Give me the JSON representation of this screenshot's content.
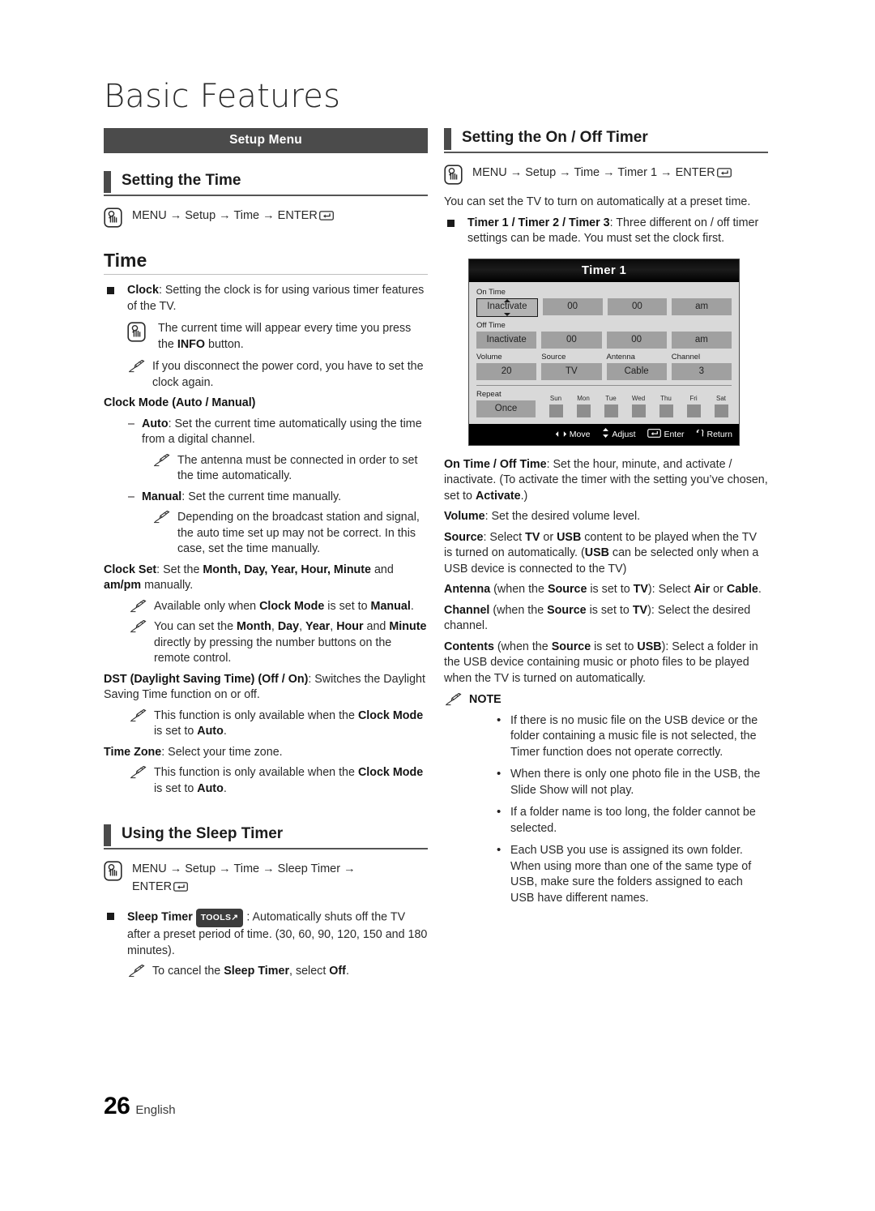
{
  "page": {
    "title": "Basic Features",
    "footer_number": "26",
    "footer_language": "English"
  },
  "left_column": {
    "banner": "Setup Menu",
    "section1_heading": "Setting the Time",
    "section1_path": "MENU → Setup → Time → ENTER",
    "subhead_time": "Time",
    "clock_item": {
      "term": "Clock",
      "text": ": Setting the clock is for using various timer features of the TV."
    },
    "clock_remote_note_pre": "The current time will appear every time you press the ",
    "clock_remote_note_bold": "INFO",
    "clock_remote_note_post": " button.",
    "clock_pencil_note": "If you disconnect the power cord, you have to set the clock again.",
    "clock_mode_heading": "Clock Mode (Auto / Manual)",
    "auto_term": "Auto",
    "auto_text": ": Set the current time automatically using the time from a digital channel.",
    "auto_note": "The antenna must be connected in order to set the time automatically.",
    "manual_term": "Manual",
    "manual_text": ": Set the current time manually.",
    "manual_note": "Depending on the broadcast station and signal, the auto time set up may not be correct. In this case, set the time manually.",
    "clock_set_term": "Clock Set",
    "clock_set_text_1": ": Set the ",
    "clock_set_bold_1": "Month, Day, Year, Hour, Minute",
    "clock_set_text_2": " and ",
    "clock_set_bold_2": "am/pm",
    "clock_set_text_3": " manually.",
    "clock_set_note_1_pre": "Available only when ",
    "clock_set_note_1_b1": "Clock Mode",
    "clock_set_note_1_mid": " is set to ",
    "clock_set_note_1_b2": "Manual",
    "clock_set_note_1_post": ".",
    "clock_set_note_2_pre": "You can set the ",
    "clock_set_note_2_b1": "Month",
    "clock_set_note_2_s1": ", ",
    "clock_set_note_2_b2": "Day",
    "clock_set_note_2_s2": ", ",
    "clock_set_note_2_b3": "Year",
    "clock_set_note_2_s3": ", ",
    "clock_set_note_2_b4": "Hour",
    "clock_set_note_2_s4": " and ",
    "clock_set_note_2_b5": "Minute",
    "clock_set_note_2_post": " directly by pressing the number buttons on the remote control.",
    "dst_term": "DST (Daylight Saving Time) (Off / On)",
    "dst_text": ": Switches the Daylight Saving Time function on or off.",
    "dst_note_pre": "This function is only available when the ",
    "dst_note_b1": "Clock Mode",
    "dst_note_mid": " is set to ",
    "dst_note_b2": "Auto",
    "dst_note_post": ".",
    "timezone_term": "Time Zone",
    "timezone_text": ": Select your time zone.",
    "timezone_note_pre": "This function is only available when the ",
    "timezone_note_b1": "Clock Mode",
    "timezone_note_mid": " is set to ",
    "timezone_note_b2": "Auto",
    "timezone_note_post": ".",
    "section2_heading": "Using the Sleep Timer",
    "section2_path_line1": "MENU → Setup → Time → Sleep Timer →",
    "section2_path_line2": "ENTER",
    "sleep_term": "Sleep Timer",
    "sleep_badge": "TOOLS",
    "sleep_text": " : Automatically shuts off the TV after a preset period of time. (30, 60, 90, 120, 150 and 180 minutes).",
    "sleep_note_pre": "To cancel the ",
    "sleep_note_b1": "Sleep Timer",
    "sleep_note_mid": ", select ",
    "sleep_note_b2": "Off",
    "sleep_note_post": "."
  },
  "right_column": {
    "section_heading": "Setting the On / Off Timer",
    "section_path": "MENU → Setup → Time → Timer 1 → ENTER",
    "intro": "You can set the TV to turn on automatically at a preset time.",
    "timer_term": "Timer 1 / Timer 2 / Timer 3",
    "timer_text": ": Three different on / off timer settings can be made. You must set the clock first.",
    "on_off_term": "On Time / Off Time",
    "on_off_text_1": ": Set the hour, minute, and activate / inactivate. (To activate the timer with the setting you’ve chosen, set to ",
    "on_off_bold": "Activate",
    "on_off_text_2": ".)",
    "volume_term": "Volume",
    "volume_text": ": Set the desired volume level.",
    "source_term": "Source",
    "source_t1": ": Select ",
    "source_b1": "TV",
    "source_t2": " or ",
    "source_b2": "USB",
    "source_t3": " content to be played when the TV is turned on automatically. (",
    "source_b3": "USB",
    "source_t4": " can be selected only when a USB device is connected to the TV)",
    "antenna_term": "Antenna",
    "antenna_t1": " (when the ",
    "antenna_b1": "Source",
    "antenna_t2": " is set to ",
    "antenna_b2": "TV",
    "antenna_t3": "): Select ",
    "antenna_b3": "Air",
    "antenna_t4": " or ",
    "antenna_b4": "Cable",
    "antenna_t5": ".",
    "channel_term": "Channel",
    "channel_t1": " (when the ",
    "channel_b1": "Source",
    "channel_t2": " is set to ",
    "channel_b2": "TV",
    "channel_t3": "): Select the desired channel.",
    "contents_term": "Contents",
    "contents_t1": " (when the ",
    "contents_b1": "Source",
    "contents_t2": " is set to ",
    "contents_b2": "USB",
    "contents_t3": "): Select a folder in the USB device containing music or photo files to be played when the TV is turned on automatically.",
    "note_label": "NOTE",
    "notes": [
      "If there is no music file on the USB device or the folder containing a music file is not selected, the Timer function does not operate correctly.",
      "When there is only one photo file in the USB, the Slide Show will not play.",
      "If a folder name is too long, the folder cannot be selected.",
      "Each USB you use is assigned its own folder. When using more than one of the same type of USB, make sure the folders assigned to each USB have different names."
    ]
  },
  "osd": {
    "title": "Timer 1",
    "on_time_label": "On Time",
    "on_time_cells": [
      "Inactivate",
      "00",
      "00",
      "am"
    ],
    "off_time_label": "Off Time",
    "off_time_cells": [
      "Inactivate",
      "00",
      "00",
      "am"
    ],
    "quad_labels": [
      "Volume",
      "Source",
      "Antenna",
      "Channel"
    ],
    "quad_values": [
      "20",
      "TV",
      "Cable",
      "3"
    ],
    "repeat_label": "Repeat",
    "repeat_value": "Once",
    "days": [
      "Sun",
      "Mon",
      "Tue",
      "Wed",
      "Thu",
      "Fri",
      "Sat"
    ],
    "footer_actions": [
      "Move",
      "Adjust",
      "Enter",
      "Return"
    ]
  }
}
